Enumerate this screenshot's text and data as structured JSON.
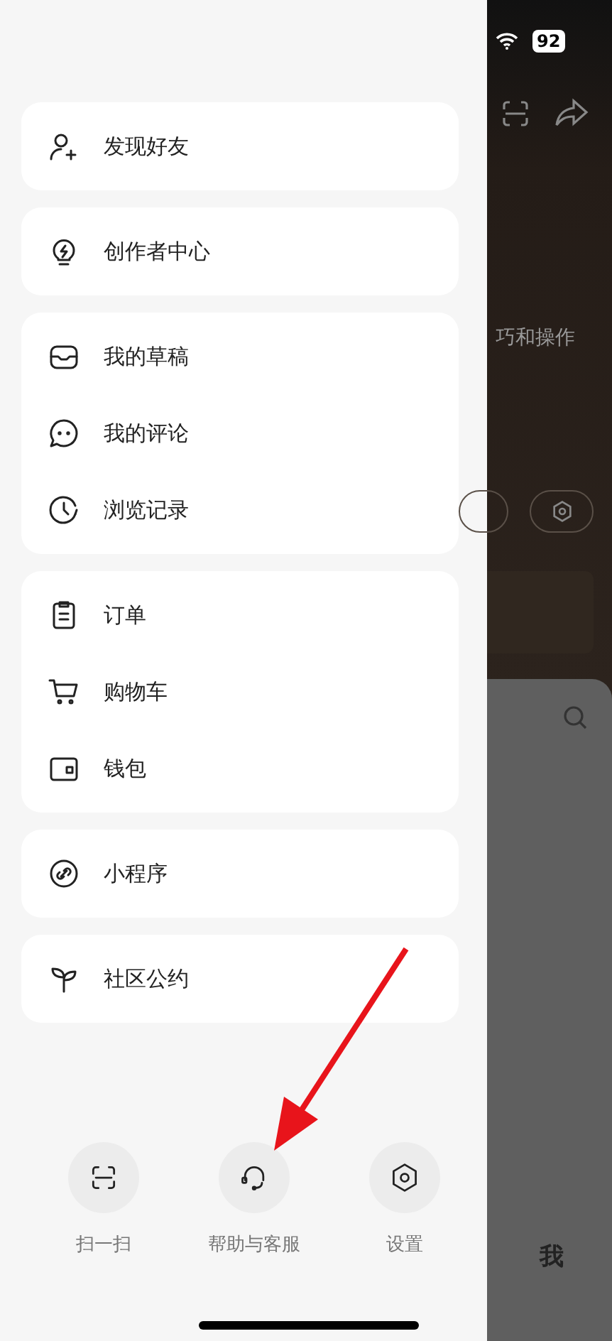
{
  "menu_groups": [
    {
      "items": [
        {
          "label": "发现好友"
        }
      ]
    },
    {
      "items": [
        {
          "label": "创作者中心"
        }
      ]
    },
    {
      "items": [
        {
          "label": "我的草稿"
        },
        {
          "label": "我的评论"
        },
        {
          "label": "浏览记录"
        }
      ]
    },
    {
      "items": [
        {
          "label": "订单"
        },
        {
          "label": "购物车"
        },
        {
          "label": "钱包"
        }
      ]
    },
    {
      "items": [
        {
          "label": "小程序"
        }
      ]
    },
    {
      "items": [
        {
          "label": "社区公约"
        }
      ]
    }
  ],
  "bottom_actions": [
    {
      "label": "扫一扫"
    },
    {
      "label": "帮助与客服"
    },
    {
      "label": "设置"
    }
  ],
  "background_page": {
    "battery": "92",
    "text_fragment": "巧和操作",
    "tab": "我"
  }
}
